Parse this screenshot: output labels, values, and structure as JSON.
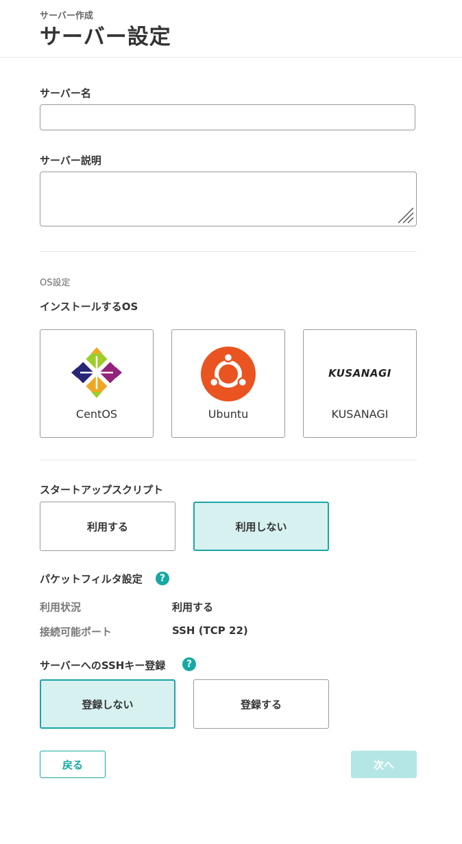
{
  "header": {
    "breadcrumb": "サーバー作成",
    "title": "サーバー設定"
  },
  "form": {
    "server_name_label": "サーバー名",
    "server_name_value": "",
    "server_desc_label": "サーバー説明",
    "server_desc_value": ""
  },
  "os": {
    "caption": "OS設定",
    "label": "インストールするOS",
    "options": [
      {
        "name": "CentOS",
        "icon": "centos-logo-icon"
      },
      {
        "name": "Ubuntu",
        "icon": "ubuntu-logo-icon",
        "color": "#e95420"
      },
      {
        "name": "KUSANAGI",
        "logo_text": "KUSANAGI"
      }
    ]
  },
  "startup": {
    "label": "スタートアップスクリプト",
    "options": [
      "利用する",
      "利用しない"
    ],
    "selected": "利用しない"
  },
  "packet_filter": {
    "label": "パケットフィルタ設定",
    "rows": [
      {
        "key": "利用状況",
        "value": "利用する"
      },
      {
        "key": "接続可能ポート",
        "value": "SSH (TCP 22)"
      }
    ]
  },
  "ssh_key": {
    "label": "サーバーへのSSHキー登録",
    "options": [
      "登録しない",
      "登録する"
    ],
    "selected": "登録しない"
  },
  "footer": {
    "back_label": "戻る",
    "next_label": "次へ"
  },
  "colors": {
    "accent": "#16a9a3",
    "selected_bg": "#d6f1f0",
    "disabled_button": "#b5e6e6"
  }
}
